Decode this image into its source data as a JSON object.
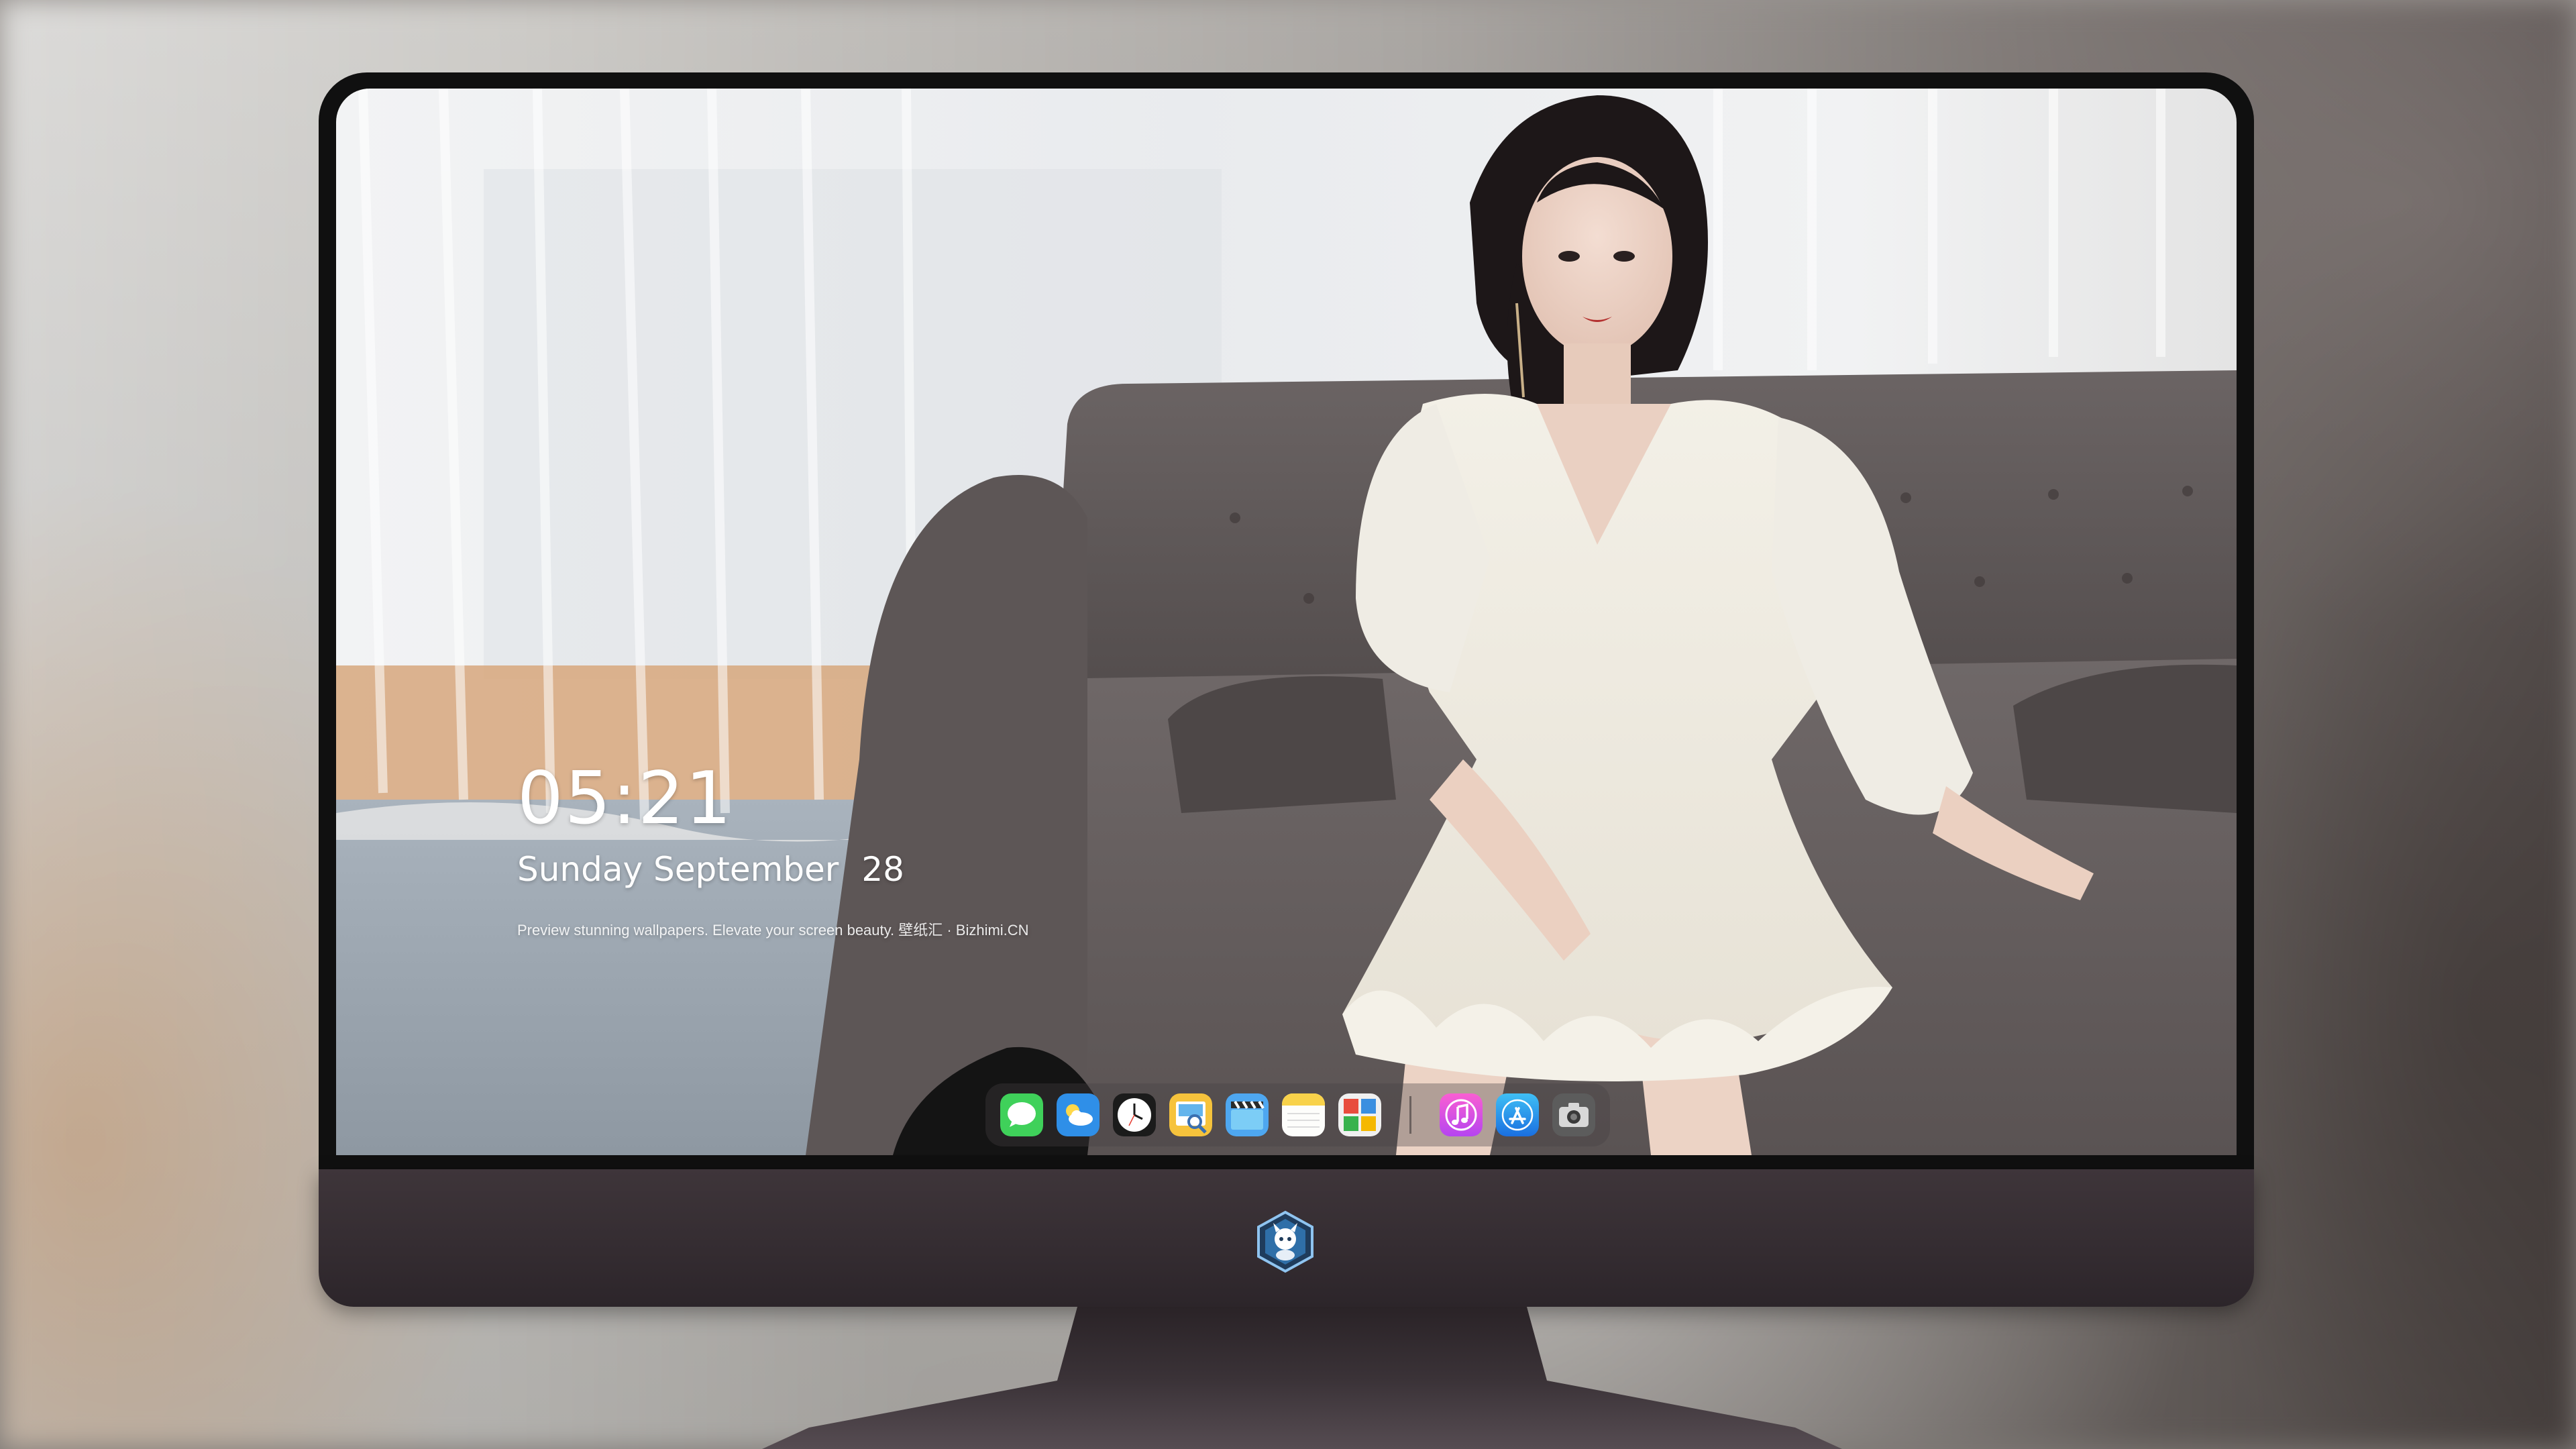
{
  "lock_screen": {
    "time": "05:21",
    "weekday_month": "Sunday September",
    "day": "28",
    "caption": "Preview stunning wallpapers. Elevate your screen beauty. 壁纸汇 · Bizhimi.CN"
  },
  "dock": {
    "apps": [
      {
        "name": "messages",
        "icon": "messages-icon"
      },
      {
        "name": "weather",
        "icon": "weather-icon"
      },
      {
        "name": "clock",
        "icon": "clock-icon"
      },
      {
        "name": "preview",
        "icon": "preview-icon"
      },
      {
        "name": "clips",
        "icon": "clapperboard-icon"
      },
      {
        "name": "notes",
        "icon": "notes-icon"
      },
      {
        "name": "photos",
        "icon": "photo-grid-icon"
      },
      {
        "name": "music",
        "icon": "music-note-icon"
      },
      {
        "name": "app-store",
        "icon": "app-store-icon"
      },
      {
        "name": "camera",
        "icon": "camera-icon"
      }
    ]
  },
  "colors": {
    "screen_bezel": "#101010",
    "monitor_chin": "#342c31",
    "clock_text": "#ffffff"
  }
}
